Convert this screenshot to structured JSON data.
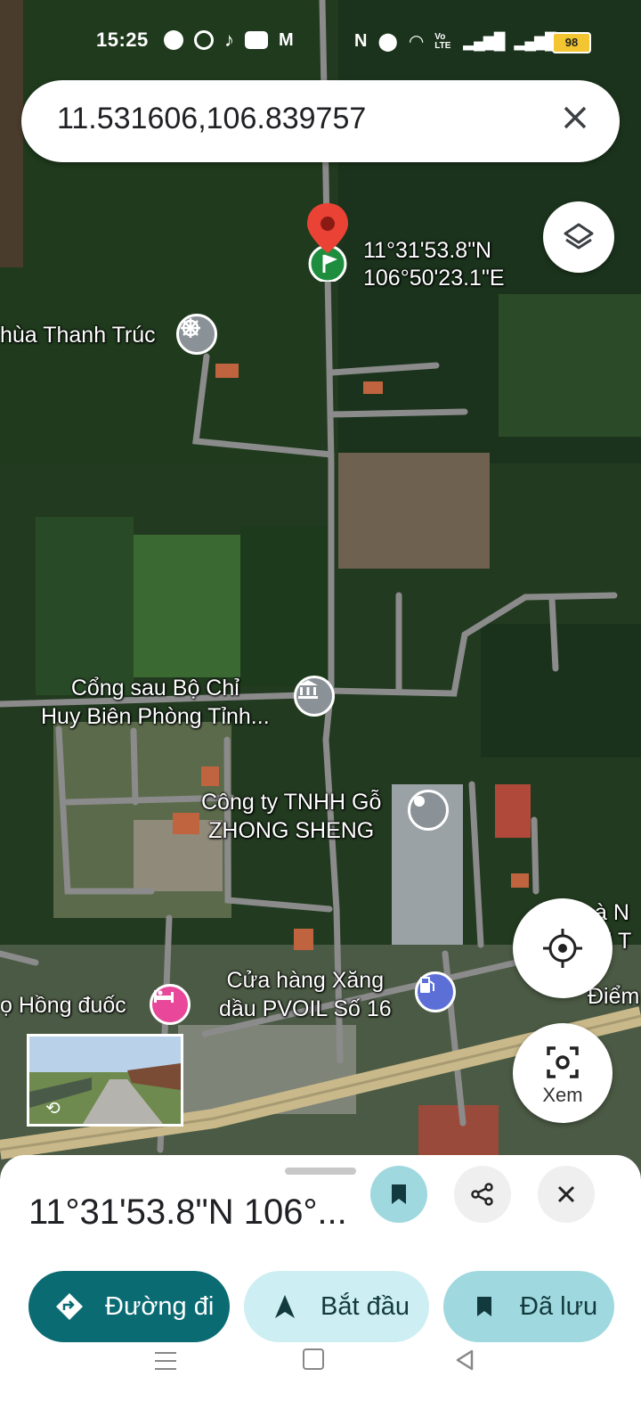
{
  "status_bar": {
    "time": "15:25",
    "notification_icons": [
      "messenger-icon",
      "chrome-icon",
      "tiktok-icon",
      "youtube-icon",
      "gmail-icon"
    ],
    "system_icons": [
      "nfc-icon",
      "location-icon",
      "wifi-icon",
      "volte-icon",
      "signal-icon",
      "signal-icon"
    ],
    "volte_text": "Vo LTE",
    "battery": "98"
  },
  "search": {
    "query": "11.531606,106.839757"
  },
  "map": {
    "pin_coords": {
      "lat": "11°31'53.8\"N",
      "lng": "106°50'23.1\"E"
    },
    "places": {
      "temple": "hùa Thanh Trúc",
      "border_gate_line1": "Cổng sau Bộ Chỉ",
      "border_gate_line2": "Huy Biên Phòng Tỉnh...",
      "company_line1": "Công ty TNHH Gỗ",
      "company_line2": "ZHONG SHENG",
      "gas_line1": "Cửa hàng Xăng",
      "gas_line2": "dầu PVOIL Số 16",
      "hotel": "ọ Hồng đuốc",
      "right_edge_1": "à N",
      "right_edge_2": "ối T",
      "right_edge_3": "Điểm"
    },
    "view_button_label": "Xem"
  },
  "sheet": {
    "title": "11°31'53.8\"N 106°...",
    "actions": {
      "directions": "Đường đi",
      "start": "Bắt đầu",
      "saved": "Đã lưu"
    }
  },
  "colors": {
    "primary": "#0b6b73",
    "light_teal": "#cdeef2",
    "saved_pill": "#9fd9df",
    "pin_red": "#ea4335",
    "flag_green": "#1e8e3e",
    "poi_gray": "#8a9297",
    "gas_purple": "#5b6fd6",
    "hotel_pink": "#e8479a"
  }
}
